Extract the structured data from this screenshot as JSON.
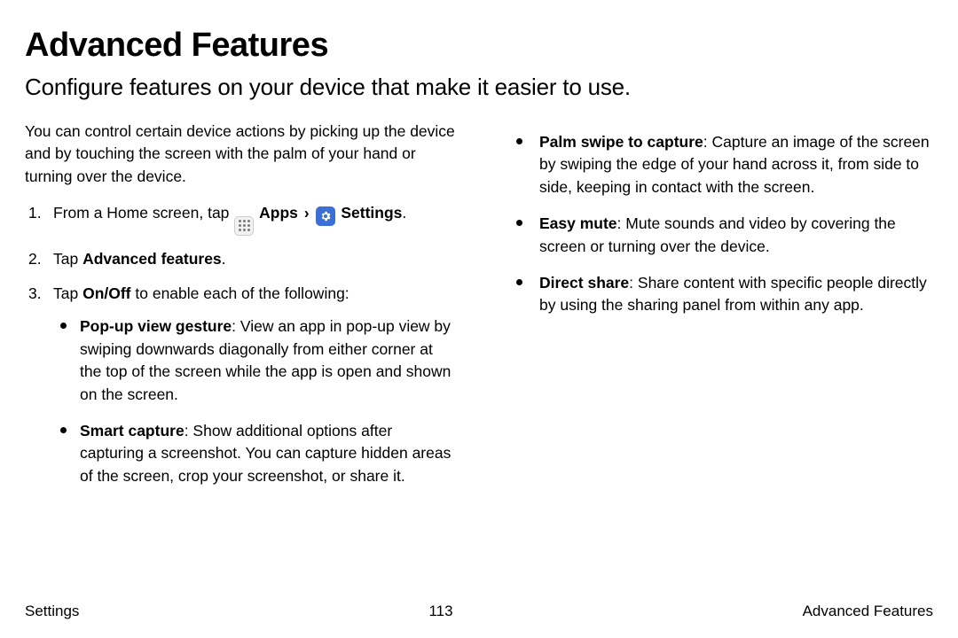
{
  "title": "Advanced Features",
  "subtitle": "Configure features on your device that make it easier to use.",
  "intro": "You can control certain device actions by picking up the device and by touching the screen with the palm of your hand or turning over the device.",
  "steps": {
    "s1_a": "From a Home screen, tap ",
    "s1_apps": "Apps",
    "s1_sep": "›",
    "s1_settings": "Settings",
    "s1_end": ".",
    "s2_a": "Tap ",
    "s2_b": "Advanced features",
    "s2_end": ".",
    "s3_a": "Tap ",
    "s3_b": "On/Off",
    "s3_c": " to enable each of the following:"
  },
  "features_left": [
    {
      "name": "Pop-up view gesture",
      "desc": ": View an app in pop-up view by swiping downwards diagonally from either corner at the top of the screen while the app is open and shown on the screen."
    },
    {
      "name": "Smart capture",
      "desc": ": Show additional options after capturing a screenshot. You can capture hidden areas of the screen, crop your screenshot, or share it."
    }
  ],
  "features_right": [
    {
      "name": "Palm swipe to capture",
      "desc": ": Capture an image of the screen by swiping the edge of your hand across it, from side to side, keeping in contact with the screen."
    },
    {
      "name": "Easy mute",
      "desc": ": Mute sounds and video by covering the screen or turning over the device."
    },
    {
      "name": "Direct share",
      "desc": ": Share content with specific people directly by using the sharing panel from within any app."
    }
  ],
  "footer": {
    "left": "Settings",
    "page": "113",
    "right": "Advanced Features"
  }
}
